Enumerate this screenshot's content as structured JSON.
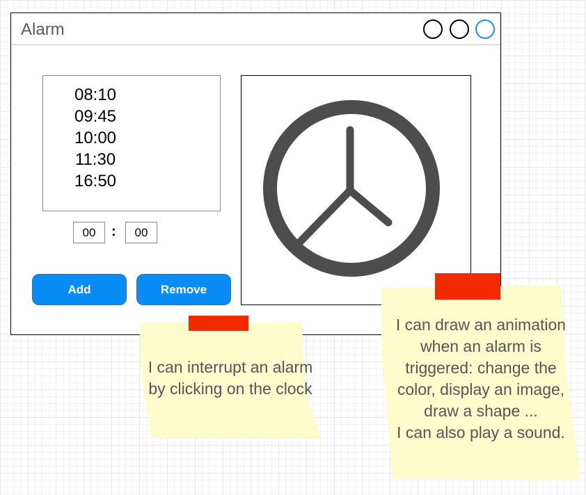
{
  "window": {
    "title": "Alarm",
    "controls": [
      "circle-button",
      "circle-button",
      "circle-button-active"
    ]
  },
  "alarms": [
    "08:10",
    "09:45",
    "10:00",
    "11:30",
    "16:50"
  ],
  "time_input": {
    "hours": "00",
    "separator": ":",
    "minutes": "00"
  },
  "buttons": {
    "add": "Add",
    "remove": "Remove"
  },
  "clock": {
    "icon": "clock-icon",
    "color": "#4d4d4d"
  },
  "notes": {
    "interrupt": {
      "lines": [
        "I can interrupt an alarm",
        "by clicking on the clock"
      ]
    },
    "animation": {
      "lines": [
        "I can draw an animation",
        "when an alarm is",
        "triggered: change the",
        "color, display an image,",
        "draw a shape ...",
        "I can also play a sound."
      ]
    }
  },
  "colors": {
    "accent": "#0a8cf7",
    "note": "#fdfccc",
    "tape": "#f12a00",
    "active_control": "#1a8ee8"
  }
}
